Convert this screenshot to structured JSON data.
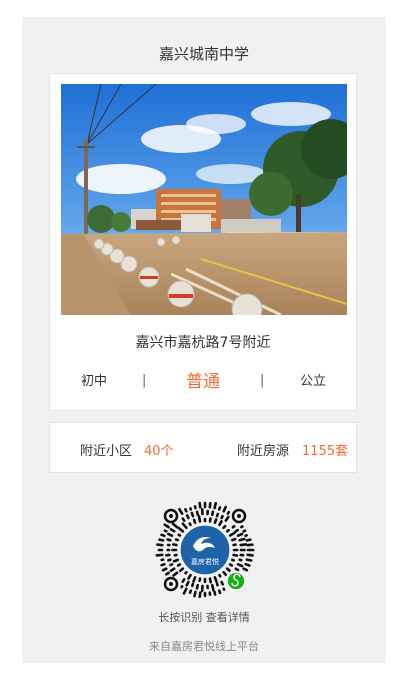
{
  "school": {
    "name": "嘉兴城南中学"
  },
  "photo": {
    "description": ""
  },
  "location": {
    "address": "嘉兴市嘉杭路7号附近"
  },
  "attributes": {
    "level": "初中",
    "category": "普通",
    "ownership": "公立",
    "separator": "|"
  },
  "stats": {
    "nearby_communities_label": "附近小区",
    "nearby_communities_value": "40个",
    "nearby_listings_label": "附近房源",
    "nearby_listings_value": "1155套"
  },
  "qrcode": {
    "logo_text": "嘉房君悦",
    "hint": "长按识别 查看详情"
  },
  "footer": {
    "text": "来自嘉房君悦线上平台"
  },
  "colors": {
    "accent": "#f06b35",
    "panel": "#f1f1f3",
    "qr_logo": "#1e63a8",
    "miniapp": "#1aad19"
  }
}
